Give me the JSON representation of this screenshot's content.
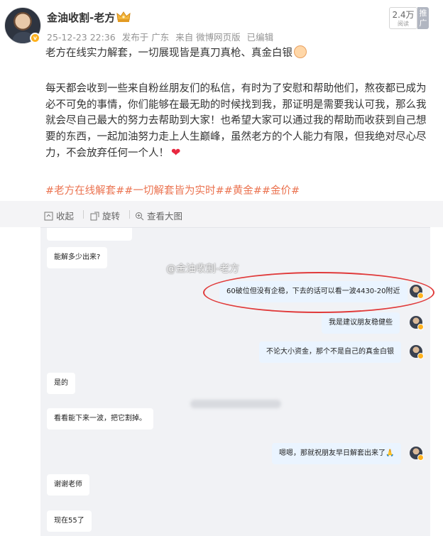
{
  "author": {
    "name": "金油收割-老方",
    "badge_icon": "crown-icon",
    "verified_icon": "verified-v-icon"
  },
  "meta": {
    "time": "25-12-23 22:36",
    "location": "发布于 广东",
    "source": "来自 微博网页版",
    "edited": "已编辑"
  },
  "stats": {
    "views": "2.4万",
    "views_label": "阅读",
    "promote": "推广"
  },
  "post": {
    "line1": "老方在线实力解套，一切展现皆是真刀真枪、真金白银",
    "paragraph": "每天都会收到一些来自粉丝朋友们的私信，有时为了安慰和帮助他们，熬夜都已成为必不可免的事情，你们能够在最无助的时候找到我，那证明是需要我认可我，那么我就会尽自己最大的努力去帮助到大家！也希望大家可以通过我的帮助而收获到自己想要的东西，一起加油努力走上人生巅峰，虽然老方的个人能力有限，但我绝对尽心尽力，不会放弃任何一个人！",
    "hashtags": "#老方在线解套##一切解套皆为实时##黄金##金价#"
  },
  "toolbar": {
    "collapse": "收起",
    "rotate": "旋转",
    "view_large": "查看大图"
  },
  "chat": {
    "watermark": "@金油收割-老方",
    "messages": [
      {
        "side": "left",
        "text": "能解多少出来?"
      },
      {
        "side": "right",
        "text": "60破位但没有企稳，下去的话可以看一波4430-20附近"
      },
      {
        "side": "right",
        "text": "我是建议朋友稳健些"
      },
      {
        "side": "right",
        "text": "不论大小资金，那个不是自己的真金白银"
      },
      {
        "side": "left",
        "text": "是的"
      },
      {
        "side": "left",
        "text": "看看能下来一波，把它割掉。"
      },
      {
        "side": "right",
        "text": "嗯嗯，那就祝朋友早日解套出来了🙏"
      },
      {
        "side": "left",
        "text": "谢谢老师"
      },
      {
        "side": "left",
        "text": "现在55了"
      }
    ]
  },
  "colors": {
    "hashtag": "#eb7350",
    "annotation_ring": "#e03a3a",
    "right_bubble": "#eaf4ff"
  }
}
